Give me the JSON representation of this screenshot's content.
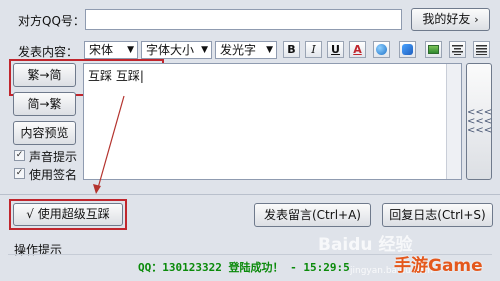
{
  "labels": {
    "qq_number": "对方QQ号：",
    "post_content": "发表内容：",
    "operation_tips": "操作提示"
  },
  "buttons": {
    "my_friends": "我的好友",
    "traditional": "繁→简",
    "simplified": "简→繁",
    "preview": "内容预览",
    "super_stomp": "√ 使用超级互踩",
    "post_message": "发表留言(Ctrl+A)",
    "reply_log": "回复日志(Ctrl+S)",
    "collapse": "<<<"
  },
  "toolbar": {
    "font": "宋体",
    "font_size": "字体大小",
    "glow": "发光字",
    "bold": "B",
    "italic": "I",
    "underline": "U",
    "color": "A"
  },
  "inputs": {
    "qq_value": "",
    "content": "互踩 互踩|"
  },
  "options": {
    "sound_prompt": "声音提示",
    "use_signature": "使用签名"
  },
  "status": {
    "message": "QQ：130123322 登陆成功！ - 15:29:5"
  },
  "watermark": {
    "baidu": "Baidu 经验",
    "site": "jingyan.baidu.com",
    "logo": "手游Game"
  },
  "colors": {
    "highlight": "#c0262d",
    "status_text": "#0a8a0a"
  }
}
